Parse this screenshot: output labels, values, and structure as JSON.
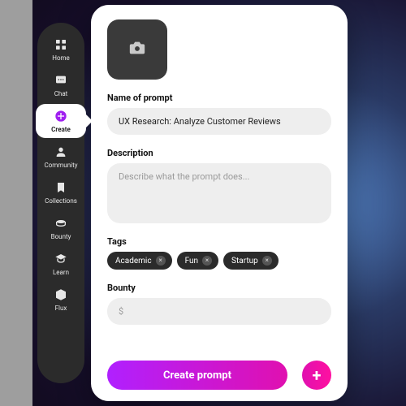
{
  "sidebar": {
    "items": [
      {
        "key": "home",
        "label": "Home"
      },
      {
        "key": "chat",
        "label": "Chat"
      },
      {
        "key": "create",
        "label": "Create"
      },
      {
        "key": "community",
        "label": "Community"
      },
      {
        "key": "collections",
        "label": "Collections"
      },
      {
        "key": "bounty",
        "label": "Bounty"
      },
      {
        "key": "learn",
        "label": "Learn"
      },
      {
        "key": "flux",
        "label": "Flux"
      }
    ],
    "active_index": 2
  },
  "form": {
    "name_label": "Name of prompt",
    "name_value": "UX Research: Analyze Customer Reviews",
    "description_label": "Description",
    "description_value": "",
    "description_placeholder": "Describe what the prompt does...",
    "tags_label": "Tags",
    "tags": [
      "Academic",
      "Fun",
      "Startup"
    ],
    "bounty_label": "Bounty",
    "bounty_value": "",
    "bounty_placeholder": "$"
  },
  "cta": {
    "submit_label": "Create prompt",
    "plus_label": "+"
  },
  "icons": {
    "camera": "camera-icon",
    "close": "×"
  }
}
